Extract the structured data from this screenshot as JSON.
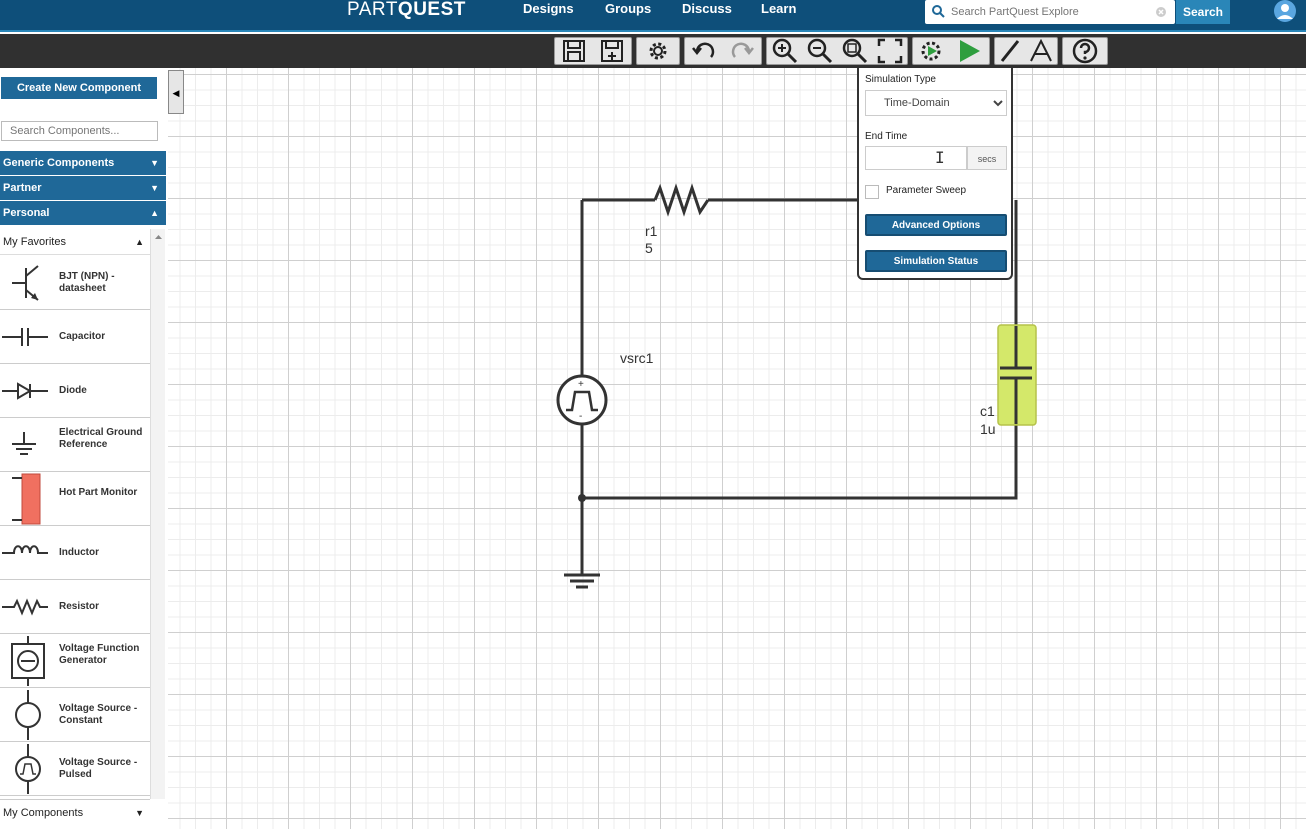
{
  "header": {
    "logo_part": "PART",
    "logo_quest": "QUEST",
    "nav": [
      "Designs",
      "Groups",
      "Discuss",
      "Learn"
    ],
    "search_placeholder": "Search PartQuest Explore",
    "search_button": "Search"
  },
  "sidebar": {
    "create_button": "Create New Component",
    "search_placeholder": "Search Components...",
    "categories": [
      {
        "label": "Generic Components",
        "arrow": "▼"
      },
      {
        "label": "Partner",
        "arrow": "▼"
      },
      {
        "label": "Personal",
        "arrow": "▲"
      }
    ],
    "favorites_label": "My Favorites",
    "favorites_arrow": "▲",
    "favorites": [
      {
        "label": "BJT (NPN) - datasheet",
        "icon": "bjt-npn-icon"
      },
      {
        "label": "Capacitor",
        "icon": "capacitor-icon"
      },
      {
        "label": "Diode",
        "icon": "diode-icon"
      },
      {
        "label": "Electrical Ground Reference",
        "icon": "ground-icon"
      },
      {
        "label": "Hot Part Monitor",
        "icon": "hot-part-monitor-icon"
      },
      {
        "label": "Inductor",
        "icon": "inductor-icon"
      },
      {
        "label": "Resistor",
        "icon": "resistor-icon"
      },
      {
        "label": "Voltage Function Generator",
        "icon": "function-generator-icon"
      },
      {
        "label": "Voltage Source - Constant",
        "icon": "voltage-source-constant-icon"
      },
      {
        "label": "Voltage Source - Pulsed",
        "icon": "voltage-source-pulsed-icon"
      }
    ],
    "my_components_label": "My Components",
    "my_components_arrow": "▼"
  },
  "simulation_panel": {
    "type_label": "Simulation Type",
    "type_value": "Time-Domain",
    "end_time_label": "End Time",
    "end_time_value": "",
    "end_time_units": "secs",
    "parameter_sweep_label": "Parameter Sweep",
    "advanced_button": "Advanced Options",
    "status_button": "Simulation Status"
  },
  "schematic": {
    "resistor": {
      "name": "r1",
      "value": "5"
    },
    "source": {
      "name": "vsrc1"
    },
    "capacitor": {
      "name": "c1",
      "value": "1u"
    }
  },
  "colors": {
    "header_bg": "#0e4f7a",
    "accent": "#1f6898",
    "toolbar_bg": "#303030",
    "run_green": "#2e9e3e",
    "capacitor_fill": "#d4e86a",
    "hot_part_red": "#f07060"
  }
}
